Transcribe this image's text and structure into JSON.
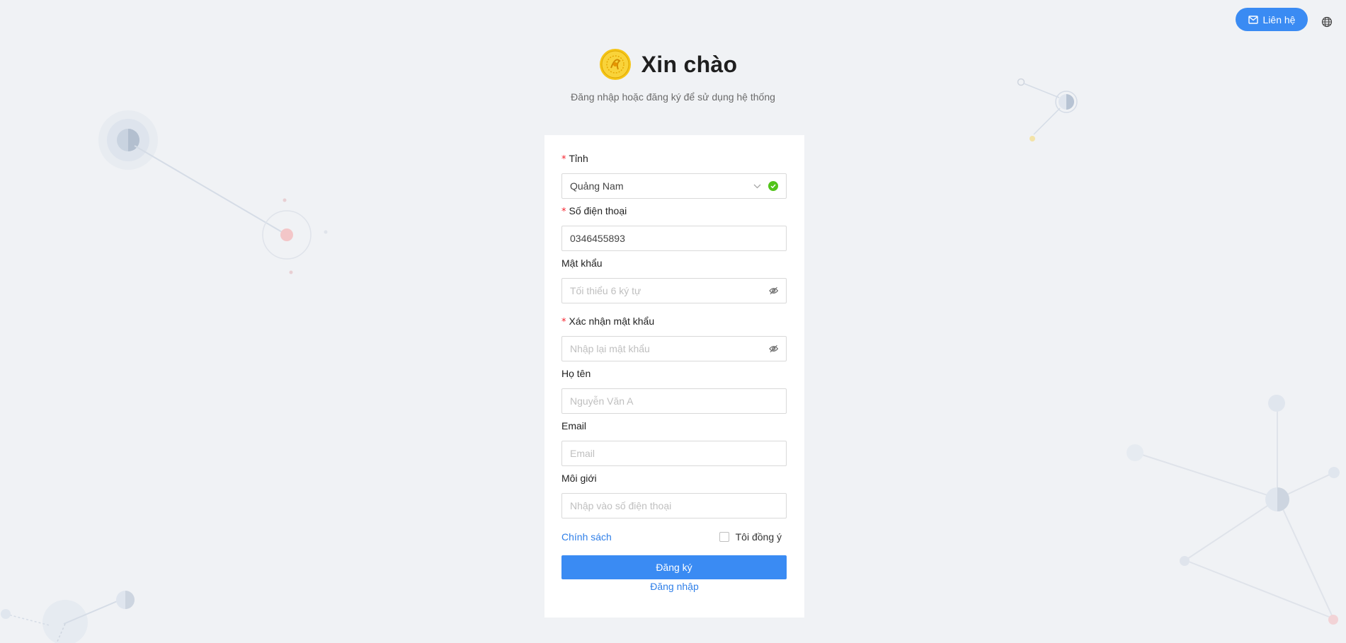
{
  "header": {
    "title": "Xin chào",
    "subtitle": "Đăng nhập hoặc đăng ký để sử dụng hệ thống",
    "contact_label": "Liên hệ"
  },
  "icons": {
    "contact": "mail-icon",
    "language": "globe-icon",
    "province_dropdown": "chevron-down-icon",
    "province_valid": "check-circle-icon",
    "password_toggle": "eye-invisible-icon"
  },
  "form": {
    "province": {
      "label": "Tỉnh",
      "value": "Quảng Nam",
      "required": true
    },
    "phone": {
      "label": "Số điện thoại",
      "value": "0346455893",
      "required": true
    },
    "password": {
      "label": "Mật khẩu",
      "placeholder": "Tối thiểu 6 ký tự"
    },
    "confirm_password": {
      "label": "Xác nhận mật khẩu",
      "placeholder": "Nhập lại mật khẩu",
      "required": true
    },
    "full_name": {
      "label": "Họ tên",
      "placeholder": "Nguyễn Văn A"
    },
    "email": {
      "label": "Email",
      "placeholder": "Email"
    },
    "broker": {
      "label": "Môi giới",
      "placeholder": "Nhập vào số điện thoại"
    },
    "required_mark": "*",
    "policy_link": "Chính sách",
    "agree_label": "Tôi đồng ý",
    "agree_checked": false,
    "submit_label": "Đăng ký",
    "login_link": "Đăng nhập"
  },
  "colors": {
    "primary": "#3a8bf3",
    "link": "#2f7fe8",
    "required": "#f5222d",
    "success": "#52c41a",
    "background": "#f0f2f5",
    "logo_gold": "#f5c518"
  }
}
